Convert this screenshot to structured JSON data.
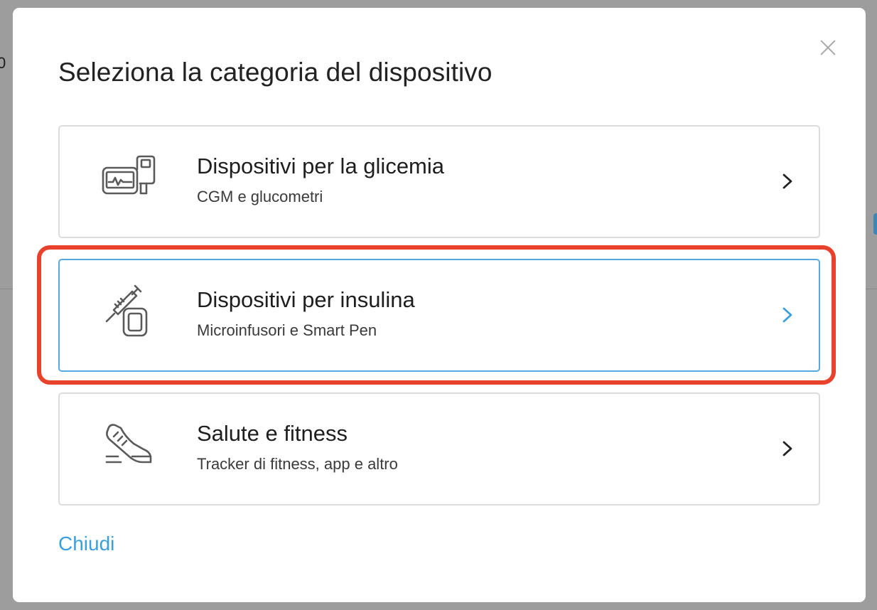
{
  "backdrop": {
    "partial_text": "0"
  },
  "modal": {
    "title": "Seleziona la categoria del dispositivo",
    "close_link": "Chiudi",
    "close_icon": "close-icon"
  },
  "categories": [
    {
      "title": "Dispositivi per la glicemia",
      "subtitle": "CGM e glucometri",
      "icon": "glucose-meter-icon",
      "selected": false
    },
    {
      "title": "Dispositivi per insulina",
      "subtitle": "Microinfusori e Smart Pen",
      "icon": "insulin-syringe-icon",
      "selected": true
    },
    {
      "title": "Salute e fitness",
      "subtitle": "Tracker di fitness, app e altro",
      "icon": "sneaker-icon",
      "selected": false
    }
  ],
  "colors": {
    "accent": "#3aa0dd",
    "selected_border": "#56a8e0",
    "highlight": "#e8412c",
    "icon": "#5a5a5a"
  }
}
